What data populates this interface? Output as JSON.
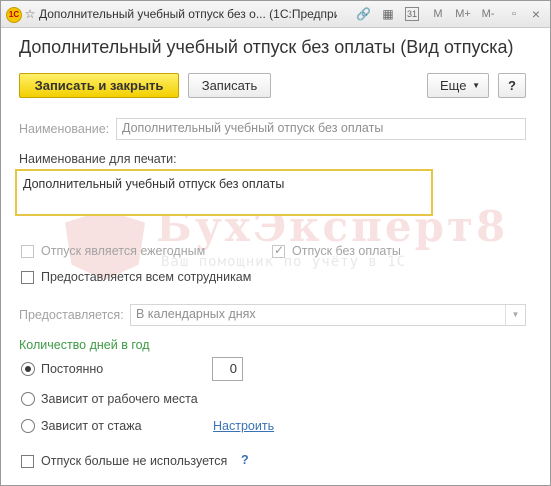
{
  "window": {
    "title": "Дополнительный учебный отпуск без о... (1С:Предприятие)",
    "logo": "1С",
    "toolbar_buttons": {
      "memory": "M",
      "memory_plus": "M+",
      "memory_minus": "M-",
      "close": "×"
    },
    "calendar_icon_text": "31"
  },
  "form": {
    "title": "Дополнительный учебный отпуск без оплаты (Вид отпуска)",
    "buttons": {
      "save_close": "Записать и закрыть",
      "save": "Записать",
      "more": "Еще",
      "help": "?"
    },
    "name_label": "Наименование:",
    "name_value": "Дополнительный учебный отпуск без оплаты",
    "print_name_label": "Наименование для печати:",
    "print_name_value": "Дополнительный учебный отпуск без оплаты",
    "checkboxes": {
      "annual": {
        "label": "Отпуск является ежегодным",
        "checked": false
      },
      "unpaid": {
        "label": "Отпуск без оплаты",
        "checked": true
      },
      "all_employees": {
        "label": "Предоставляется всем сотрудникам",
        "checked": false
      }
    },
    "provided_label": "Предоставляется:",
    "provided_value": "В календарных днях",
    "days_section": "Количество дней в год",
    "radios": {
      "constant": {
        "label": "Постоянно",
        "selected": true
      },
      "workplace": {
        "label": "Зависит от рабочего места",
        "selected": false
      },
      "seniority": {
        "label": "Зависит от стажа",
        "selected": false
      }
    },
    "days_value": "0",
    "configure_link": "Настроить",
    "not_used": {
      "label": "Отпуск больше не используется",
      "checked": false
    },
    "not_used_help": "?"
  },
  "watermark": {
    "brand": "БухЭксперт8",
    "tagline": "Ваш помощник по учёту в 1С"
  }
}
